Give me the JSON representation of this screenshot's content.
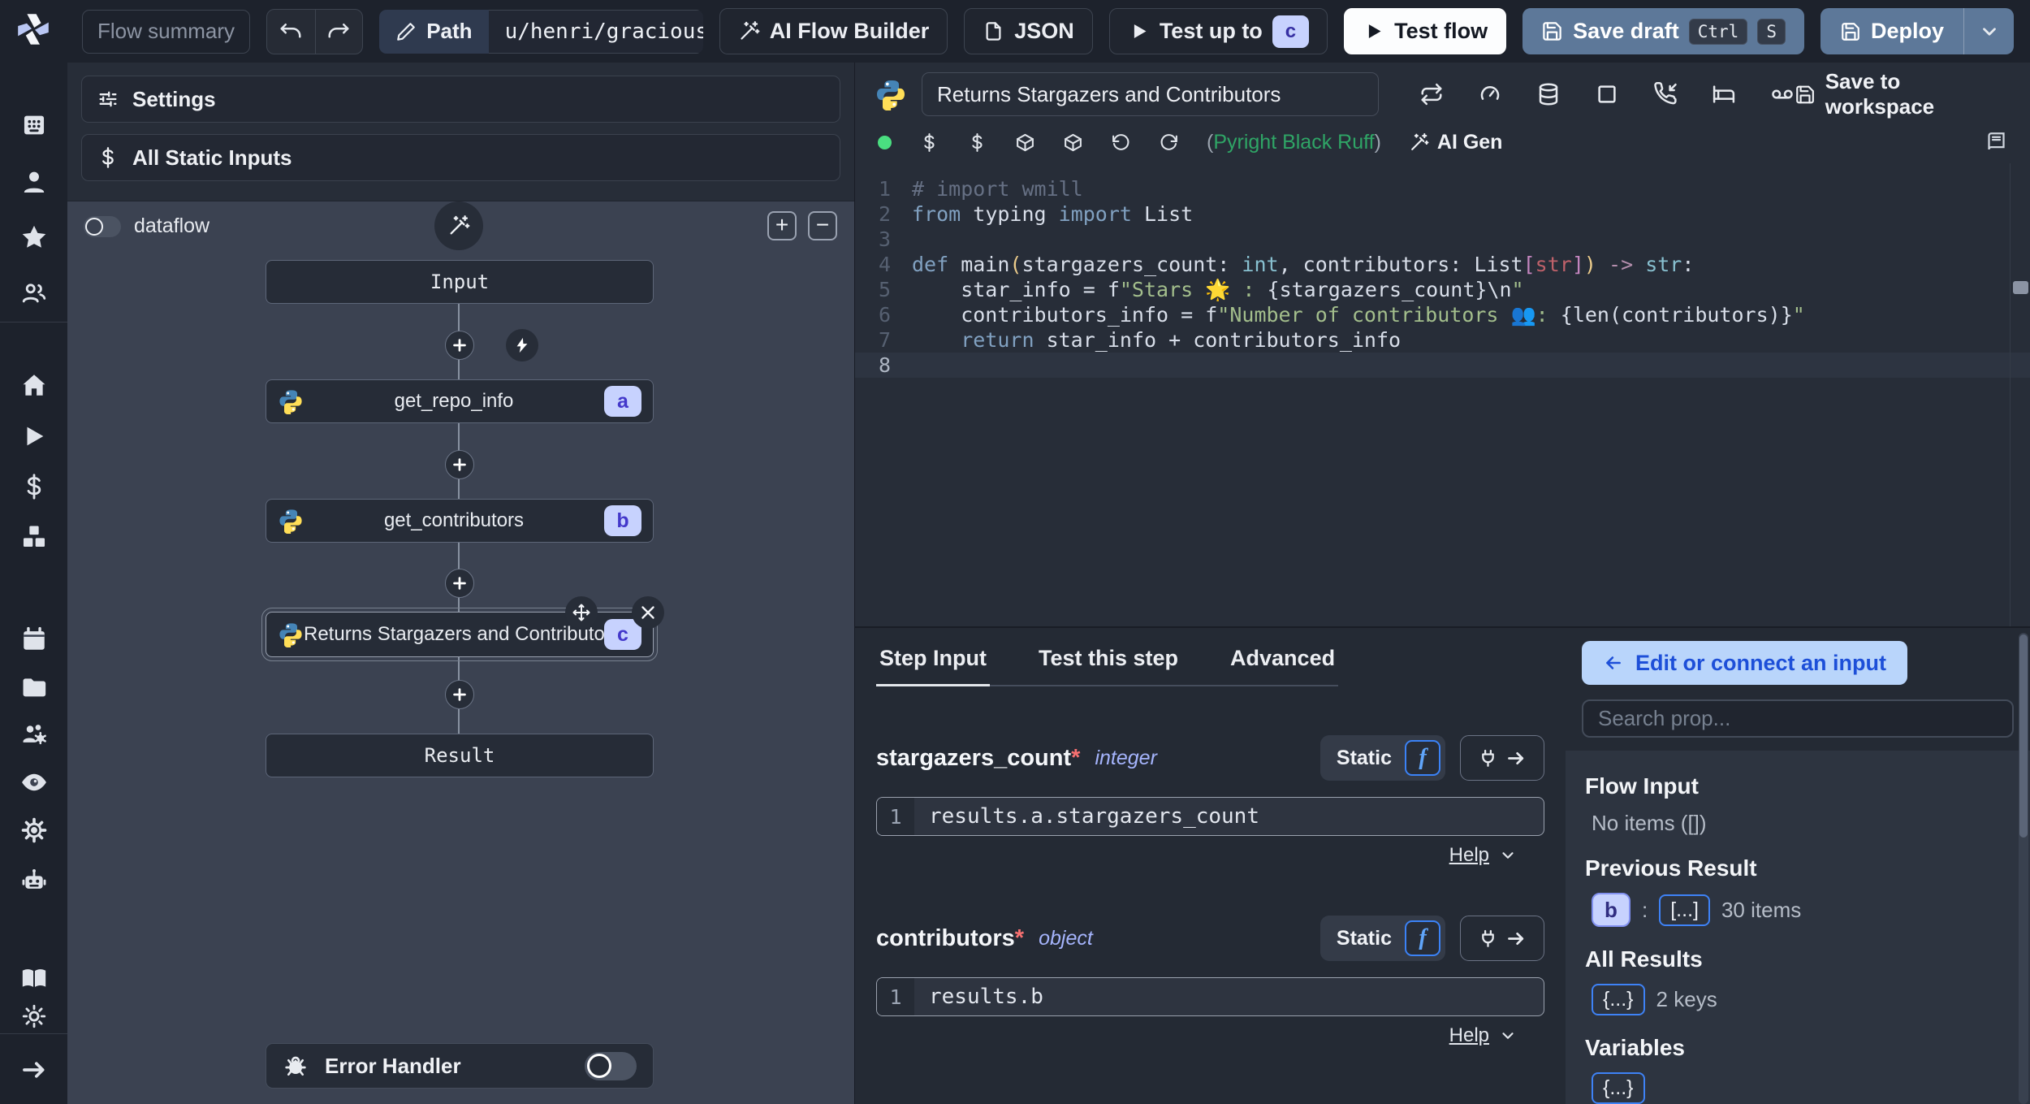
{
  "topbar": {
    "flow_summary_placeholder": "Flow summary",
    "path_label": "Path",
    "path_value": "u/henri/gracious_flow",
    "ai_flow_builder_label": "AI Flow Builder",
    "json_label": "JSON",
    "test_up_to_label": "Test up to",
    "test_up_to_badge": "c",
    "test_flow_label": "Test flow",
    "save_draft_label": "Save draft",
    "save_draft_keys": [
      "Ctrl",
      "S"
    ],
    "deploy_label": "Deploy"
  },
  "sidebar": {
    "logo": "windmill-logo",
    "icons": [
      "app-grid-icon",
      "user-icon",
      "star-icon",
      "users-icon",
      "home-icon",
      "play-icon",
      "dollar-icon",
      "cubes-icon",
      "calendar-icon",
      "folder-icon",
      "users-gear-icon",
      "eye-icon",
      "gear-icon",
      "robot-icon",
      "book-open-icon",
      "sun-icon",
      "arrow-right-icon"
    ]
  },
  "flow_panel": {
    "settings_label": "Settings",
    "all_static_inputs_label": "All Static Inputs",
    "dataflow_label": "dataflow",
    "input_node_label": "Input",
    "result_node_label": "Result",
    "error_handler_label": "Error Handler",
    "steps": [
      {
        "badge": "a",
        "label": "get_repo_info",
        "selected": false
      },
      {
        "badge": "b",
        "label": "get_contributors",
        "selected": false
      },
      {
        "badge": "c",
        "label": "Returns Stargazers and Contributors",
        "selected": true
      }
    ]
  },
  "editor": {
    "title_value": "Returns Stargazers and Contributors",
    "save_to_workspace_label": "Save to workspace",
    "toolbar_icons_row1": [
      "repeat-icon",
      "gauge-icon",
      "database-icon",
      "square-icon",
      "phone-incoming-icon",
      "bed-icon",
      "voicemail-icon"
    ],
    "toolbar_icons_row2": [
      "dollar-icon",
      "dollar-icon",
      "package-icon",
      "package-icon",
      "rotate-ccw-icon",
      "refresh-cw-icon"
    ],
    "assistant_open_paren": "(",
    "assistant_label": "Pyright Black Ruff",
    "assistant_close_paren": ")",
    "ai_gen_label": "AI Gen",
    "code": {
      "current_line": 8,
      "lines": [
        {
          "n": "1",
          "toks": [
            {
              "s": "# import wmill",
              "c": "cm"
            }
          ]
        },
        {
          "n": "2",
          "toks": [
            {
              "s": "from",
              "c": "kw"
            },
            {
              "s": " typing ",
              "c": "pl"
            },
            {
              "s": "import",
              "c": "kw"
            },
            {
              "s": " List",
              "c": "pl"
            }
          ]
        },
        {
          "n": "3",
          "toks": []
        },
        {
          "n": "4",
          "toks": [
            {
              "s": "def",
              "c": "kw"
            },
            {
              "s": " main",
              "c": "pl"
            },
            {
              "s": "(",
              "c": "pa"
            },
            {
              "s": "stargazers_count: ",
              "c": "pl"
            },
            {
              "s": "int",
              "c": "ty"
            },
            {
              "s": ", contributors: List",
              "c": "pl"
            },
            {
              "s": "[",
              "c": "br"
            },
            {
              "s": "str",
              "c": "rd"
            },
            {
              "s": "]",
              "c": "br"
            },
            {
              "s": ")",
              "c": "pa"
            },
            {
              "s": " ",
              "c": "pl"
            },
            {
              "s": "->",
              "c": "op"
            },
            {
              "s": " ",
              "c": "pl"
            },
            {
              "s": "str",
              "c": "ty"
            },
            {
              "s": ":",
              "c": "pl"
            }
          ]
        },
        {
          "n": "5",
          "toks": [
            {
              "s": "    star_info = f",
              "c": "pl"
            },
            {
              "s": "\"Stars 🌟 : ",
              "c": "st"
            },
            {
              "s": "{stargazers_count}\\n",
              "c": "pl"
            },
            {
              "s": "\"",
              "c": "st"
            }
          ]
        },
        {
          "n": "6",
          "toks": [
            {
              "s": "    contributors_info = f",
              "c": "pl"
            },
            {
              "s": "\"Number of contributors 👥: ",
              "c": "st"
            },
            {
              "s": "{len(contributors)}",
              "c": "pl"
            },
            {
              "s": "\"",
              "c": "st"
            }
          ]
        },
        {
          "n": "7",
          "toks": [
            {
              "s": "    ",
              "c": "pl"
            },
            {
              "s": "return",
              "c": "kw"
            },
            {
              "s": " star_info + contributors_info",
              "c": "pl"
            }
          ]
        },
        {
          "n": "8",
          "toks": []
        }
      ]
    }
  },
  "step_panel": {
    "tabs": [
      "Step Input",
      "Test this step",
      "Advanced"
    ],
    "active_tab": "Step Input",
    "static_label": "Static",
    "fn_icon": "f",
    "help_label": "Help",
    "fields": [
      {
        "name": "stargazers_count",
        "required": "*",
        "type": "integer",
        "gutter": "1",
        "expr": "results.a.stargazers_count"
      },
      {
        "name": "contributors",
        "required": "*",
        "type": "object",
        "gutter": "1",
        "expr": "results.b"
      }
    ]
  },
  "props_panel": {
    "edit_connect_label": "Edit or connect an input",
    "search_placeholder": "Search prop...",
    "sections": [
      {
        "title": "Flow Input",
        "kind": "text",
        "text": "No items ([])"
      },
      {
        "title": "Previous Result",
        "kind": "badge",
        "badge": "b",
        "sep": ":",
        "chip": "[...]",
        "suffix": "30 items"
      },
      {
        "title": "All Results",
        "kind": "chip",
        "chip": "{...}",
        "suffix": "2 keys"
      },
      {
        "title": "Variables",
        "kind": "chip",
        "chip": "{...}",
        "suffix": ""
      }
    ]
  },
  "colors": {
    "accent_blue": "#3b82f6",
    "badge_lavender": "#c7d2fe",
    "badge_indigo_text": "#3730a3",
    "steel_button": "#5d7899",
    "status_green": "#4ade80",
    "assistant_green": "#2fa566",
    "graph_bg": "#3b4251",
    "panel_bg": "#272d38",
    "topbar_bg": "#1d222c"
  }
}
